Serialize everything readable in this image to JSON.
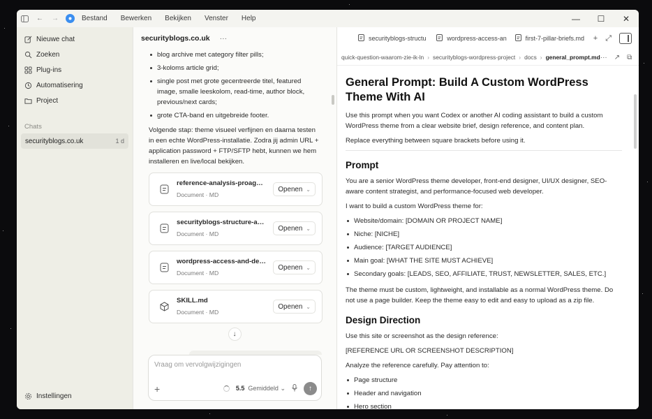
{
  "menu": [
    "Bestand",
    "Bewerken",
    "Bekijken",
    "Venster",
    "Help"
  ],
  "sidebar": {
    "nav": [
      {
        "label": "Nieuwe chat",
        "icon": "edit-icon"
      },
      {
        "label": "Zoeken",
        "icon": "search-icon"
      },
      {
        "label": "Plug-ins",
        "icon": "plugins-icon"
      },
      {
        "label": "Automatisering",
        "icon": "clock-icon"
      },
      {
        "label": "Project",
        "icon": "folder-icon"
      }
    ],
    "section_label": "Chats",
    "chats": [
      {
        "title": "securityblogs.co.uk",
        "age": "1 d"
      }
    ],
    "settings_label": "Instellingen"
  },
  "chat": {
    "title": "securityblogs.co.uk",
    "bullets": [
      "blog archive met category filter pills;",
      "3-koloms article grid;",
      "single post met grote gecentreerde titel, featured image, smalle leeskolom, read-time, author block, previous/next cards;",
      "grote CTA-band en uitgebreide footer."
    ],
    "paragraph": "Volgende stap: theme visueel verfijnen en daarna testen in een echte WordPress-installatie. Zodra jij admin URL + application password + FTP/SFTP hebt, kunnen we hem installeren en live/local bekijken.",
    "files": [
      {
        "name": "reference-analysis-proagen…",
        "meta": "Document · MD",
        "icon": "document-icon",
        "action": "Openen"
      },
      {
        "name": "securityblogs-structure-an…",
        "meta": "Document · MD",
        "icon": "document-icon",
        "action": "Openen"
      },
      {
        "name": "wordpress-access-and-depl…",
        "meta": "Document · MD",
        "icon": "document-icon",
        "action": "Openen"
      },
      {
        "name": "SKILL.md",
        "meta": "Document · MD",
        "icon": "cube-icon",
        "action": "Openen"
      }
    ],
    "composer": {
      "placeholder": "Vraag om vervolgwijzigingen",
      "model": "5.5",
      "level": "Gemiddeld"
    }
  },
  "doc": {
    "tabs": [
      "securityblogs-structu",
      "wordpress-access-an",
      "first-7-pillar-briefs.md"
    ],
    "breadcrumb": [
      "quick-question-waarom-zie-ik-ln",
      "securityblogs-wordpress-project",
      "docs",
      "general_prompt.md"
    ],
    "title": "General Prompt: Build A Custom WordPress Theme With AI",
    "intro": "Use this prompt when you want Codex or another AI coding assistant to build a custom WordPress theme from a clear website brief, design reference, and content plan.",
    "intro2": "Replace everything between square brackets before using it.",
    "prompt_heading": "Prompt",
    "prompt_p1": "You are a senior WordPress theme developer, front-end designer, UI/UX designer, SEO-aware content strategist, and performance-focused web developer.",
    "prompt_p2": "I want to build a custom WordPress theme for:",
    "prompt_list": [
      "Website/domain: [DOMAIN OR PROJECT NAME]",
      "Niche: [NICHE]",
      "Audience: [TARGET AUDIENCE]",
      "Main goal: [WHAT THE SITE MUST ACHIEVE]",
      "Secondary goals: [LEADS, SEO, AFFILIATE, TRUST, NEWSLETTER, SALES, ETC.]"
    ],
    "prompt_p3": "The theme must be custom, lightweight, and installable as a normal WordPress theme. Do not use a page builder. Keep the theme easy to edit and easy to upload as a zip file.",
    "design_heading": "Design Direction",
    "design_p1": "Use this site or screenshot as the design reference:",
    "design_p2": "[REFERENCE URL OR SCREENSHOT DESCRIPTION]",
    "design_p3": "Analyze the reference carefully. Pay attention to:",
    "design_list": [
      "Page structure",
      "Header and navigation",
      "Hero section"
    ]
  }
}
